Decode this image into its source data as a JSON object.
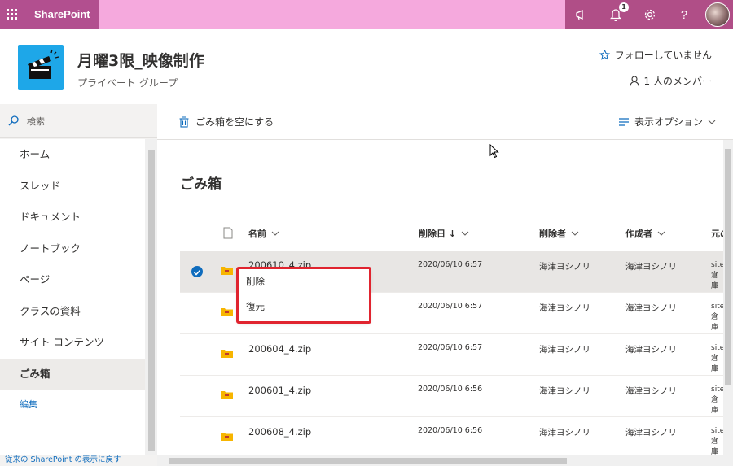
{
  "suite": {
    "brand": "SharePoint",
    "notification_count": "1"
  },
  "site": {
    "title": "月曜3限_映像制作",
    "subtitle": "プライベート グループ",
    "follow": "フォローしていません",
    "members": "1 人のメンバー"
  },
  "nav": {
    "search": "検索",
    "items": [
      "ホーム",
      "スレッド",
      "ドキュメント",
      "ノートブック",
      "ページ",
      "クラスの資料",
      "サイト コンテンツ",
      "ごみ箱"
    ],
    "edit": "編集",
    "footer": "従来の SharePoint の表示に戻す"
  },
  "command": {
    "empty_recycle": "ごみ箱を空にする",
    "view_options": "表示オプション"
  },
  "main": {
    "title": "ごみ箱",
    "columns": {
      "name": "名前",
      "deleted_date": "削除日 ↓",
      "deleted_by": "削除者",
      "created_by": "作成者",
      "original": "元の"
    },
    "rows": [
      {
        "name": "200610_4.zip",
        "date": "2020/06/10 6:57",
        "deleted_by": "海津ヨシノリ",
        "created_by": "海津ヨシノリ",
        "orig1": "site",
        "orig2": "倉庫"
      },
      {
        "name": "",
        "date": "2020/06/10 6:57",
        "deleted_by": "海津ヨシノリ",
        "created_by": "海津ヨシノリ",
        "orig1": "site",
        "orig2": "倉庫"
      },
      {
        "name": "200604_4.zip",
        "date": "2020/06/10 6:57",
        "deleted_by": "海津ヨシノリ",
        "created_by": "海津ヨシノリ",
        "orig1": "site",
        "orig2": "倉庫"
      },
      {
        "name": "200601_4.zip",
        "date": "2020/06/10 6:56",
        "deleted_by": "海津ヨシノリ",
        "created_by": "海津ヨシノリ",
        "orig1": "site",
        "orig2": "倉庫"
      },
      {
        "name": "200608_4.zip",
        "date": "2020/06/10 6:56",
        "deleted_by": "海津ヨシノリ",
        "created_by": "海津ヨシノリ",
        "orig1": "site",
        "orig2": "倉庫"
      }
    ]
  },
  "context_menu": {
    "delete": "削除",
    "restore": "復元"
  },
  "colors": {
    "suitebar": "#f5a9dd",
    "suitebar_dark": "#b24f8f",
    "accent": "#0f6cbd",
    "highlight": "#e0242f",
    "folder": "#f7b500"
  }
}
